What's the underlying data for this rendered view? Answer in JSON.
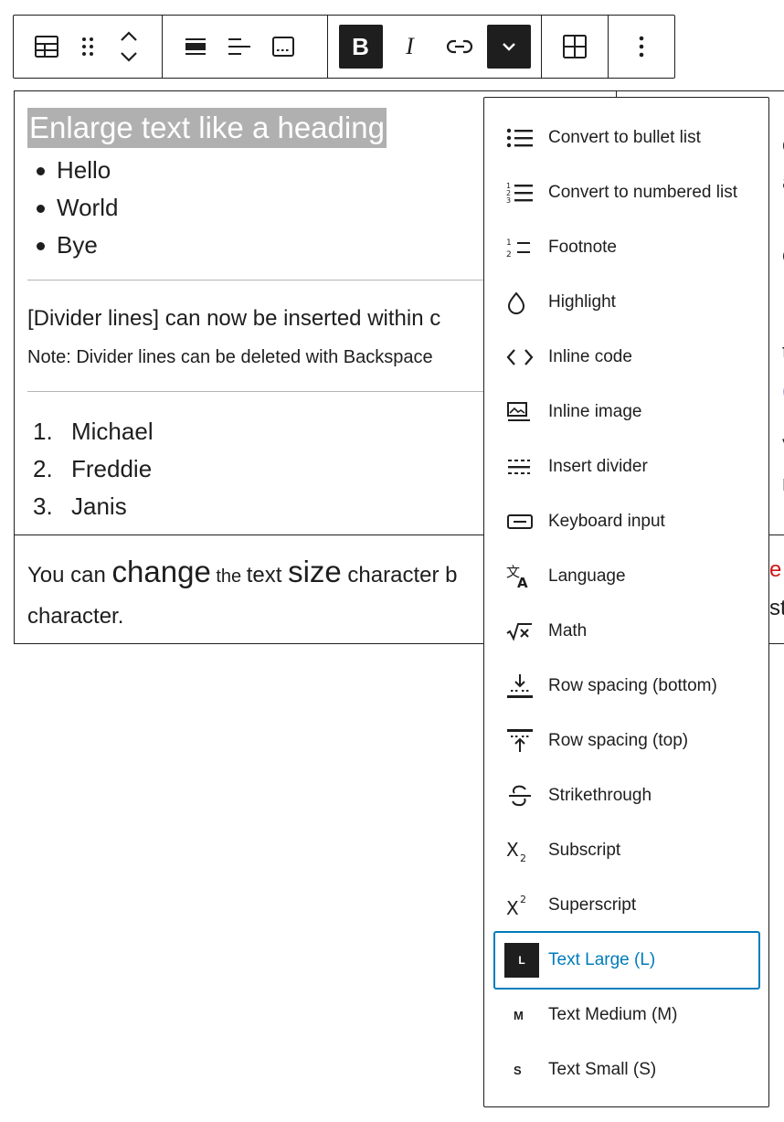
{
  "editor": {
    "heading": "Enlarge text like a heading",
    "bullets": [
      "Hello",
      "World",
      "Bye"
    ],
    "divider_text": "[Divider lines] can now be inserted within c",
    "divider_note": "Note: Divider lines can be deleted with Backspace",
    "numbered": [
      {
        "num": "1.",
        "text": "Michael"
      },
      {
        "num": "2.",
        "text": "Freddie"
      },
      {
        "num": "3.",
        "text": "Janis"
      }
    ],
    "row2": {
      "p1": "You can ",
      "p2": "change",
      "p3": " the ",
      "p4": "text ",
      "p5": "size",
      "p6": " character b",
      "line2": "character."
    },
    "right_fragments": [
      "ce",
      "ac",
      "ea",
      "to",
      "(",
      "Va",
      "m",
      "e",
      "sta"
    ]
  },
  "menu": {
    "items": [
      {
        "icon": "bullet-list-icon",
        "label": "Convert to bullet list"
      },
      {
        "icon": "numbered-list-icon",
        "label": "Convert to numbered list"
      },
      {
        "icon": "footnote-icon",
        "label": "Footnote"
      },
      {
        "icon": "highlight-drop-icon",
        "label": "Highlight"
      },
      {
        "icon": "code-icon",
        "label": "Inline code"
      },
      {
        "icon": "image-icon",
        "label": "Inline image"
      },
      {
        "icon": "divider-icon",
        "label": "Insert divider"
      },
      {
        "icon": "keyboard-icon",
        "label": "Keyboard input"
      },
      {
        "icon": "language-icon",
        "label": "Language"
      },
      {
        "icon": "math-icon",
        "label": "Math"
      },
      {
        "icon": "row-spacing-bottom-icon",
        "label": "Row spacing (bottom)"
      },
      {
        "icon": "row-spacing-top-icon",
        "label": "Row spacing (top)"
      },
      {
        "icon": "strikethrough-icon",
        "label": "Strikethrough"
      },
      {
        "icon": "subscript-icon",
        "label": "Subscript"
      },
      {
        "icon": "superscript-icon",
        "label": "Superscript"
      },
      {
        "icon": "text-large-icon",
        "label": "Text Large (L)",
        "badge": "L",
        "selected": true
      },
      {
        "icon": "text-medium-icon",
        "label": "Text Medium (M)",
        "badge": "M"
      },
      {
        "icon": "text-small-icon",
        "label": "Text Small (S)",
        "badge": "S"
      }
    ]
  },
  "toolbar": {
    "bold_label": "B",
    "italic_label": "I"
  },
  "colors": {
    "accent": "#007cba",
    "dark": "#1e1e1e",
    "highlight_bg": "#b0b0b0",
    "red_text": "#cc1818"
  }
}
